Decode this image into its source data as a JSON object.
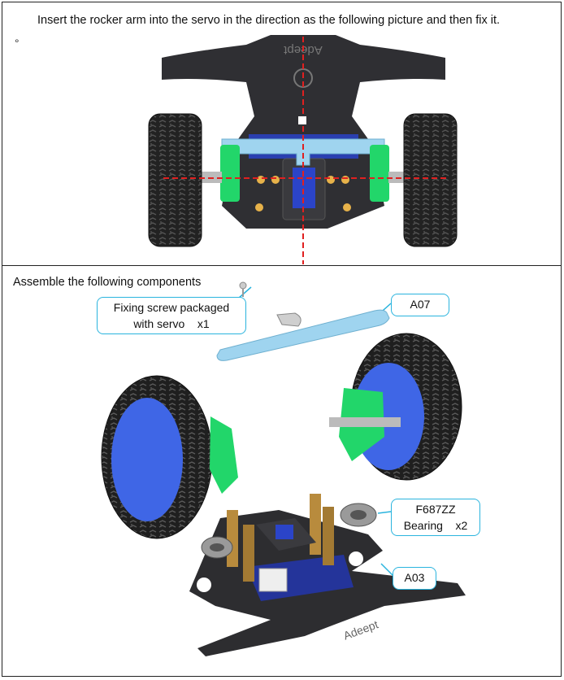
{
  "step_top": {
    "instruction": "Insert the rocker arm into the servo in the direction as the following picture and then fix it.",
    "bullet": "∘",
    "logo_text": "Adeept"
  },
  "step_bottom": {
    "heading": "Assemble the following components",
    "logo_text": "Adeept",
    "labels": {
      "screw_line1": "Fixing screw packaged",
      "screw_line2": "with servo    x1",
      "arm": "A07",
      "bearing_line1": "F687ZZ",
      "bearing_line2": "Bearing    x2",
      "chassis": "A03"
    }
  },
  "colors": {
    "callout_border": "#2ab4de",
    "rocker_arm": "#9fd4ef",
    "servo_mount": "#22d66a",
    "wheel_hub": "#3f66e6",
    "chassis": "#2d2d30",
    "guide_line": "#e02020"
  }
}
